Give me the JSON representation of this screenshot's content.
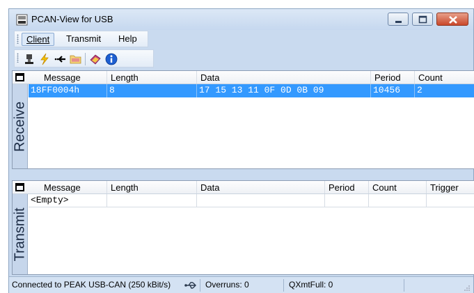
{
  "window": {
    "title": "PCAN-View for USB"
  },
  "menu": {
    "items": [
      "Client",
      "Transmit",
      "Help"
    ]
  },
  "toolbar": {
    "icons": [
      "connect-icon",
      "lightning-icon",
      "arrow-icon",
      "folder-icon",
      "book-icon",
      "info-icon"
    ]
  },
  "receive": {
    "side_label": "Receive",
    "columns": [
      "Message",
      "Length",
      "Data",
      "Period",
      "Count"
    ],
    "rows": [
      {
        "message": "18FF0004h",
        "length": "8",
        "data": "17 15 13 11 0F 0D 0B 09",
        "period": "10456",
        "count": "2"
      }
    ]
  },
  "transmit": {
    "side_label": "Transmit",
    "columns": [
      "Message",
      "Length",
      "Data",
      "Period",
      "Count",
      "Trigger"
    ],
    "rows": [
      {
        "message": "<Empty>",
        "length": "",
        "data": "",
        "period": "",
        "count": "",
        "trigger": ""
      }
    ]
  },
  "status": {
    "connection": "Connected to PEAK USB-CAN (250 kBit/s)",
    "overruns": "Overruns: 0",
    "qxmtfull": "QXmtFull: 0"
  },
  "colors": {
    "selection": "#3399ff",
    "chrome": "#c9daef",
    "close_button": "#c9472b"
  }
}
